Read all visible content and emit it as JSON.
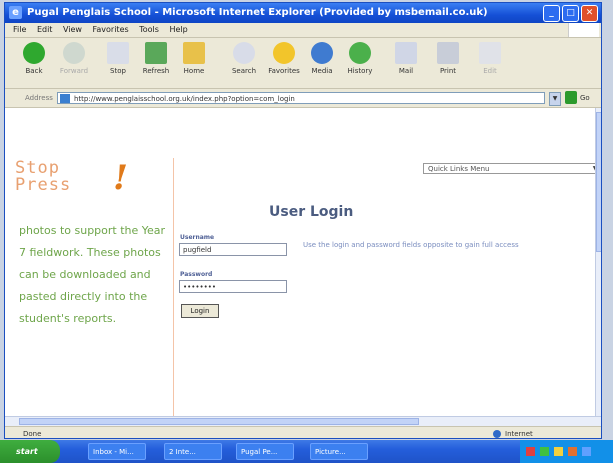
{
  "window": {
    "title": "Pugal Penglais School - Microsoft Internet Explorer (Provided by msbemail.co.uk)"
  },
  "menu": [
    "File",
    "Edit",
    "View",
    "Favorites",
    "Tools",
    "Help"
  ],
  "toolbar": {
    "back": "Back",
    "forward": "Forward",
    "stop": "Stop",
    "refresh": "Refresh",
    "home": "Home",
    "search": "Search",
    "favorites": "Favorites",
    "media": "Media",
    "history": "History",
    "mail": "Mail",
    "print": "Print",
    "edit": "Edit"
  },
  "address": {
    "label": "Address",
    "url": "http://www.penglaisschool.org.uk/index.php?option=com_login",
    "go": "Go"
  },
  "page": {
    "logo_line1": "Stop",
    "logo_line2": "Press",
    "logo_bang": "!",
    "side_text": "photos to support the Year 7 fieldwork. These photos can be downloaded and pasted directly into the student's reports.",
    "quick_links": "Quick Links Menu",
    "login_heading": "User Login",
    "username_label": "Username",
    "username_value": "pugfield",
    "password_label": "Password",
    "password_value": "••••••••",
    "login_button": "Login",
    "hint": "Use the login and password fields opposite to gain full access"
  },
  "status": {
    "left": "Done",
    "zone": "Internet"
  },
  "taskbar": {
    "start": "start",
    "buttons": [
      "Inbox - Mi...",
      "2 Inte...",
      "Pugal Pe...",
      "Picture..."
    ]
  }
}
